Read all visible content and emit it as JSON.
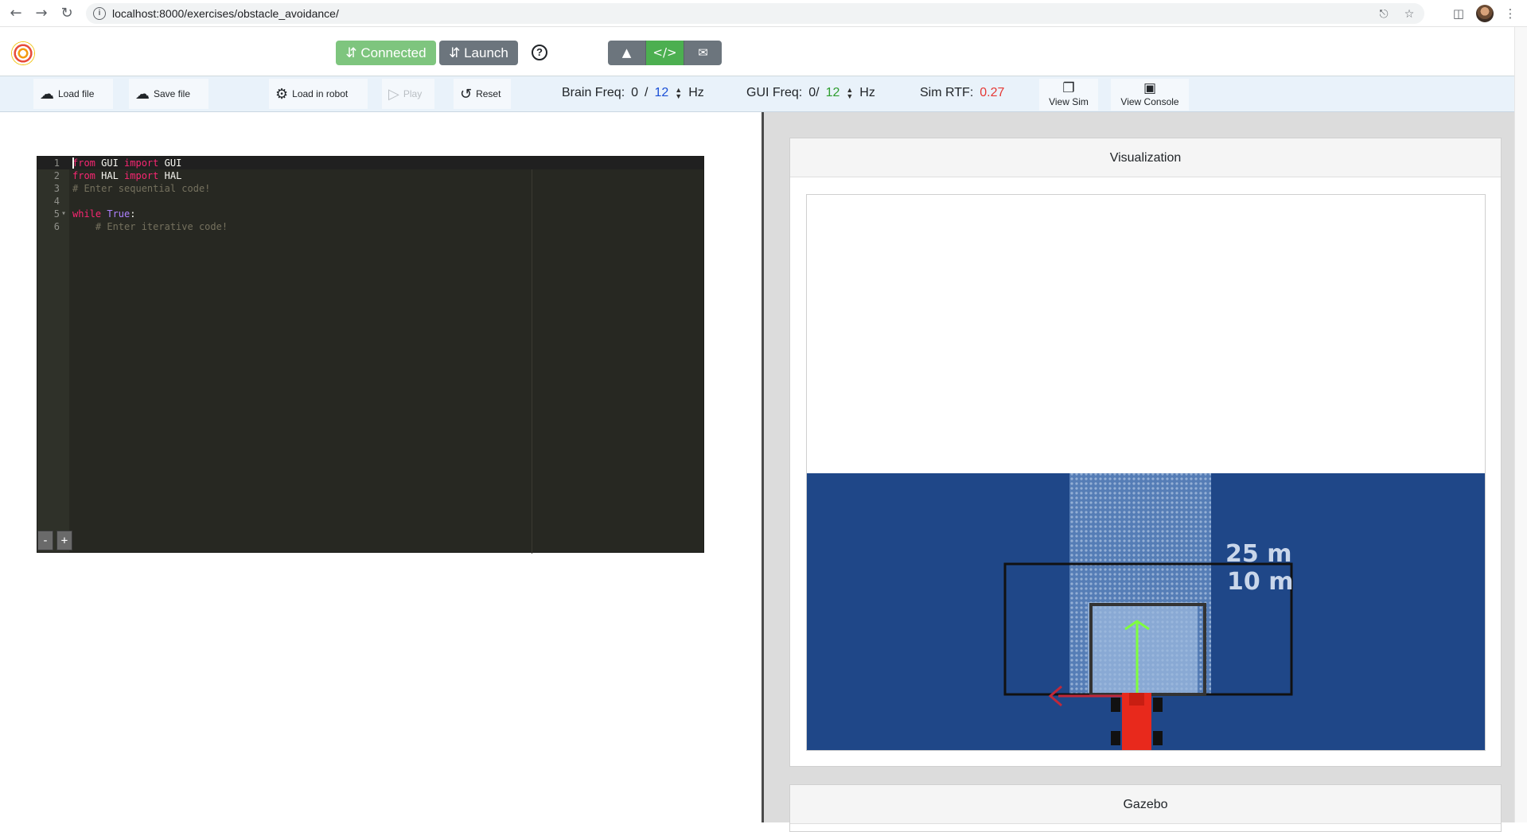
{
  "browser": {
    "url": "localhost:8000/exercises/obstacle_avoidance/"
  },
  "header": {
    "connected_label": "⇵ Connected",
    "launch_label": "⇵ Launch",
    "help_glyph": "?"
  },
  "toolbar": {
    "load_file": "Load file",
    "save_file": "Save file",
    "load_robot": "Load in robot",
    "play": "Play",
    "reset": "Reset",
    "brain_freq_label": "Brain Freq:",
    "brain_freq_value": "0",
    "brain_freq_sep": "/",
    "brain_freq_target": "12",
    "brain_freq_unit": "Hz",
    "gui_freq_label": "GUI Freq:",
    "gui_freq_value": "0/",
    "gui_freq_target": "12",
    "gui_freq_unit": "Hz",
    "sim_rtf_label": "Sim RTF:",
    "sim_rtf_value": "0.27",
    "view_sim": "View Sim",
    "view_console": "View Console"
  },
  "editor": {
    "lines": [
      {
        "n": "1",
        "parts": [
          [
            "kw",
            "from"
          ],
          [
            "",
            " GUI "
          ],
          [
            "kw",
            "import"
          ],
          [
            "",
            " GUI"
          ]
        ]
      },
      {
        "n": "2",
        "parts": [
          [
            "kw",
            "from"
          ],
          [
            "",
            " HAL "
          ],
          [
            "kw",
            "import"
          ],
          [
            "",
            " HAL"
          ]
        ]
      },
      {
        "n": "3",
        "parts": [
          [
            "cmt",
            "# Enter sequential code!"
          ]
        ]
      },
      {
        "n": "4",
        "parts": []
      },
      {
        "n": "5",
        "parts": [
          [
            "kw",
            "while"
          ],
          [
            "",
            " "
          ],
          [
            "const",
            "True"
          ],
          [
            "",
            ":"
          ]
        ],
        "fold": true
      },
      {
        "n": "6",
        "parts": [
          [
            "",
            "    "
          ],
          [
            "cmt",
            "# Enter iterative code!"
          ]
        ]
      }
    ],
    "zoom_out": "-",
    "zoom_in": "+"
  },
  "visualization": {
    "title": "Visualization",
    "label_far": "25 m",
    "label_near": "10 m",
    "colors": {
      "background": "#1f4788",
      "laser": "#8fb0d8",
      "target_arrow": "#7fff3f",
      "obstacle_arrow": "#c0283a",
      "car": "#e8291c"
    }
  },
  "gazebo": {
    "title": "Gazebo"
  }
}
